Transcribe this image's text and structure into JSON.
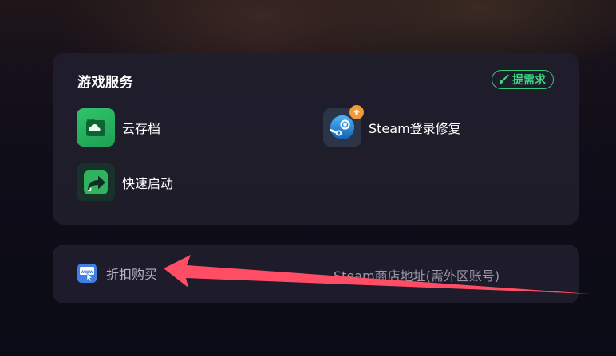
{
  "services": {
    "title": "游戏服务",
    "request_button_label": "提需求",
    "items": [
      {
        "label": "云存档",
        "icon": "cloud-save-icon"
      },
      {
        "label": "Steam登录修复",
        "icon": "steam-icon"
      },
      {
        "label": "快速启动",
        "icon": "quick-launch-icon"
      }
    ]
  },
  "shop": {
    "discount_label": "折扣购买",
    "store_link_label": "Steam商店地址(需外区账号)"
  },
  "colors": {
    "accent_green": "#2ecb78",
    "update_badge": "#f29a35",
    "arrow_annotation": "#ff4d66"
  }
}
